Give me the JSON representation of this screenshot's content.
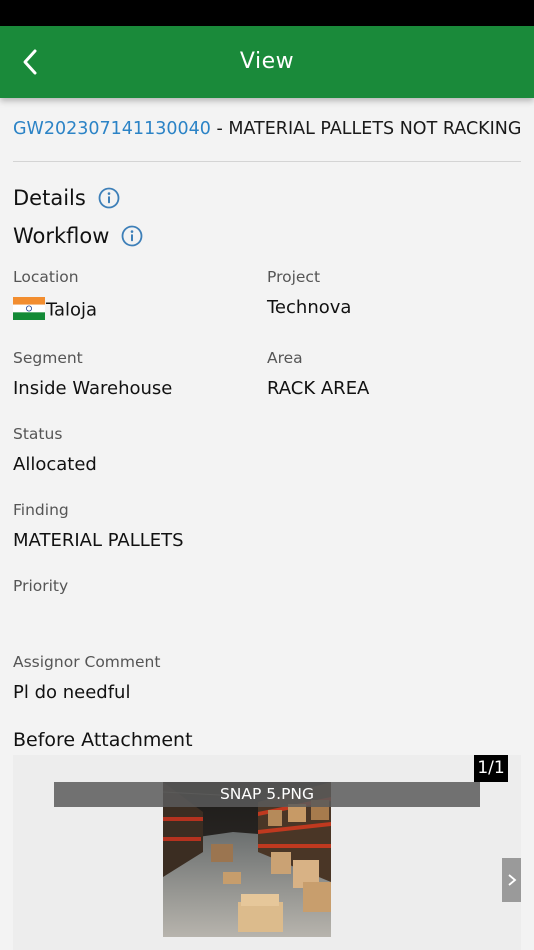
{
  "app_bar": {
    "title": "View"
  },
  "issue": {
    "code": "GW202307141130040",
    "separator": " - ",
    "title": "MATERIAL PALLETS NOT RACKING"
  },
  "sections": {
    "details": "Details",
    "workflow": "Workflow"
  },
  "fields": {
    "location": {
      "label": "Location",
      "value": "Taloja"
    },
    "project": {
      "label": "Project",
      "value": "Technova"
    },
    "segment": {
      "label": "Segment",
      "value": "Inside Warehouse"
    },
    "area": {
      "label": "Area",
      "value": "RACK AREA"
    },
    "status": {
      "label": "Status",
      "value": "Allocated"
    },
    "finding": {
      "label": "Finding",
      "value": "MATERIAL PALLETS"
    },
    "priority": {
      "label": "Priority",
      "value": ""
    },
    "assignor_comment": {
      "label": "Assignor Comment",
      "value": "Pl do needful"
    }
  },
  "attachment": {
    "title": "Before Attachment",
    "counter": "1/1",
    "file_name": "SNAP 5.PNG"
  },
  "colors": {
    "app_bar": "#1a8a3a",
    "link": "#2b83c6",
    "info_icon": "#3d7fb8"
  },
  "icons": {
    "back": "chevron-left-icon",
    "info": "info-icon",
    "next": "chevron-right-icon",
    "flag": "india-flag-icon"
  }
}
